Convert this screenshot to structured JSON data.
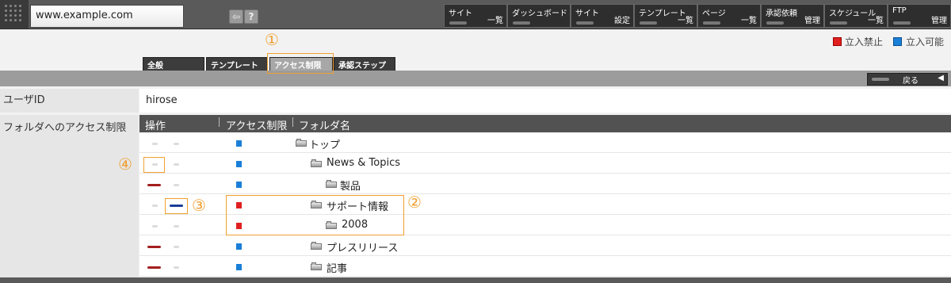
{
  "header": {
    "site": "www.example.com",
    "nav": [
      {
        "top": "サイト",
        "bottom": "一覧"
      },
      {
        "top": "ダッシュボード",
        "bottom": ""
      },
      {
        "top": "サイト",
        "bottom": "設定"
      },
      {
        "top": "テンプレート",
        "bottom": "一覧"
      },
      {
        "top": "ページ",
        "bottom": "一覧"
      },
      {
        "top": "承認依頼",
        "bottom": "管理"
      },
      {
        "top": "スケジュール",
        "bottom": "一覧"
      },
      {
        "top": "FTP",
        "bottom": "管理"
      }
    ],
    "help": "?"
  },
  "legend": {
    "restricted": "立入禁止",
    "allowed": "立入可能",
    "restricted_color": "#e02020",
    "allowed_color": "#1a7fd8"
  },
  "tabs": [
    "全般",
    "テンプレート",
    "アクセス制限",
    "承認ステップ"
  ],
  "active_tab": "アクセス制限",
  "back_label": "戻る",
  "back_arrow": "◀",
  "form": {
    "user_id_label": "ユーザID",
    "user_id_value": "hirose",
    "access_label": "フォルダへのアクセス制限"
  },
  "table": {
    "headers": [
      "操作",
      "アクセス制限",
      "フォルダ名"
    ],
    "rows": [
      {
        "folder": "トップ",
        "access": "allowed"
      },
      {
        "folder": "News & Topics",
        "access": "allowed"
      },
      {
        "folder": "製品",
        "access": "allowed"
      },
      {
        "folder": "サポート情報",
        "access": "restricted"
      },
      {
        "folder": "2008",
        "access": "restricted"
      },
      {
        "folder": "プレスリリース",
        "access": "allowed"
      },
      {
        "folder": "記事",
        "access": "allowed"
      }
    ]
  },
  "annotations": [
    "①",
    "②",
    "③",
    "④"
  ]
}
